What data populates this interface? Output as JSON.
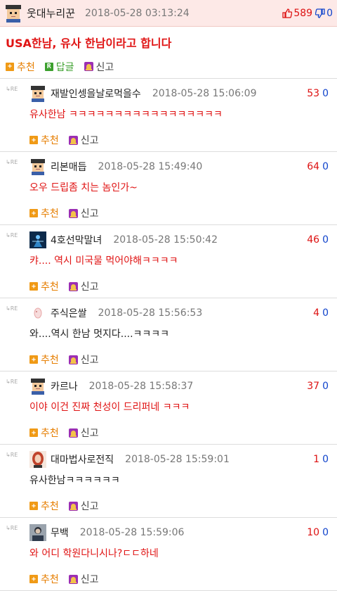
{
  "post": {
    "nickname": "웃대누리꾼",
    "date": "2018-05-28 03:13:24",
    "up": "589",
    "down": "0",
    "title": "USA한남, 유사 한남이라고 합니다",
    "actions": {
      "recommend": "추천",
      "reply": "답글",
      "report": "신고"
    }
  },
  "re_label": "RE",
  "comment_actions": {
    "recommend": "추천",
    "report": "신고"
  },
  "comments": [
    {
      "nickname": "재발인셍을날로먹을수",
      "date": "2018-05-28 15:06:09",
      "up": "53",
      "down": "0",
      "text": "유사한남 ㅋㅋㅋㅋㅋㅋㅋㅋㅋㅋㅋㅋㅋㅋㅋㅋㅋ",
      "text_color": "#e01414",
      "avatar": "pixel-character-icon"
    },
    {
      "nickname": "리본매듭",
      "date": "2018-05-28 15:49:40",
      "up": "64",
      "down": "0",
      "text": "오우 드립좀 치는 놈인가~",
      "text_color": "#e01414",
      "avatar": "pixel-character-icon"
    },
    {
      "nickname": "4호선막말녀",
      "date": "2018-05-28 15:50:42",
      "up": "46",
      "down": "0",
      "text": "캬.... 역시 미국물 먹어야해ㅋㅋㅋㅋ",
      "text_color": "#e01414",
      "avatar": "blue-figure-icon"
    },
    {
      "nickname": "주식은쌀",
      "date": "2018-05-28 15:56:53",
      "up": "4",
      "down": "0",
      "text": "와....역시 한남 멋지다....ㅋㅋㅋㅋ",
      "text_color": "#222222",
      "avatar": "pink-blob-icon"
    },
    {
      "nickname": "카르나",
      "date": "2018-05-28 15:58:37",
      "up": "37",
      "down": "0",
      "text": "이야 이건 진짜 천성이 드리퍼네 ㅋㅋㅋ",
      "text_color": "#e01414",
      "avatar": "pixel-character-icon"
    },
    {
      "nickname": "대마법사로전직",
      "date": "2018-05-28 15:59:01",
      "up": "1",
      "down": "0",
      "text": "유사한남ㅋㅋㅋㅋㅋㅋ",
      "text_color": "#222222",
      "avatar": "redhead-portrait-icon"
    },
    {
      "nickname": "무백",
      "date": "2018-05-28 15:59:06",
      "up": "10",
      "down": "0",
      "text": "와 어디 학원다니시나?ㄷㄷ하네",
      "text_color": "#e01414",
      "avatar": "photo-portrait-icon"
    }
  ]
}
